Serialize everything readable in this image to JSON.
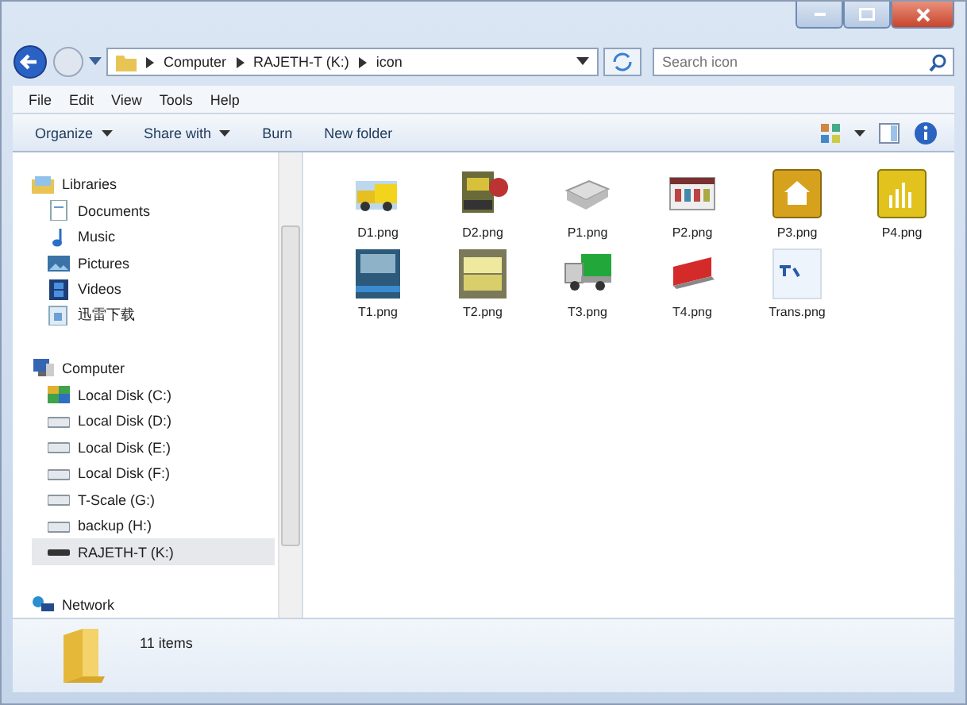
{
  "address_bar": {
    "crumbs": [
      "Computer",
      "RAJETH-T (K:)",
      "icon"
    ]
  },
  "search": {
    "placeholder": "Search icon"
  },
  "menu_bar": [
    "File",
    "Edit",
    "View",
    "Tools",
    "Help"
  ],
  "toolbar": [
    {
      "label": "Organize",
      "dropdown": true
    },
    {
      "label": "Share with",
      "dropdown": true
    },
    {
      "label": "Burn",
      "dropdown": false
    },
    {
      "label": "New folder",
      "dropdown": false
    }
  ],
  "sidebar": {
    "groups": [
      {
        "label": "Libraries",
        "children": [
          {
            "label": "Documents",
            "selected": false
          },
          {
            "label": "Music",
            "selected": false
          },
          {
            "label": "Pictures",
            "selected": false
          },
          {
            "label": "Videos",
            "selected": false
          },
          {
            "label": "迅雷下载",
            "selected": false
          }
        ]
      },
      {
        "label": "Computer",
        "children": [
          {
            "label": "Local Disk (C:)",
            "selected": false
          },
          {
            "label": "Local Disk (D:)",
            "selected": false
          },
          {
            "label": "Local Disk (E:)",
            "selected": false
          },
          {
            "label": "Local Disk (F:)",
            "selected": false
          },
          {
            "label": "T-Scale (G:)",
            "selected": false
          },
          {
            "label": "backup (H:)",
            "selected": false
          },
          {
            "label": "RAJETH-T (K:)",
            "selected": true
          }
        ]
      },
      {
        "label": "Network"
      }
    ]
  },
  "files": [
    {
      "name": "D1.png"
    },
    {
      "name": "D2.png"
    },
    {
      "name": "P1.png"
    },
    {
      "name": "P2.png"
    },
    {
      "name": "P3.png"
    },
    {
      "name": "P4.png"
    },
    {
      "name": "T1.png"
    },
    {
      "name": "T2.png"
    },
    {
      "name": "T3.png"
    },
    {
      "name": "T4.png"
    },
    {
      "name": "Trans.png"
    }
  ],
  "status_bar": {
    "count": "11 items"
  }
}
